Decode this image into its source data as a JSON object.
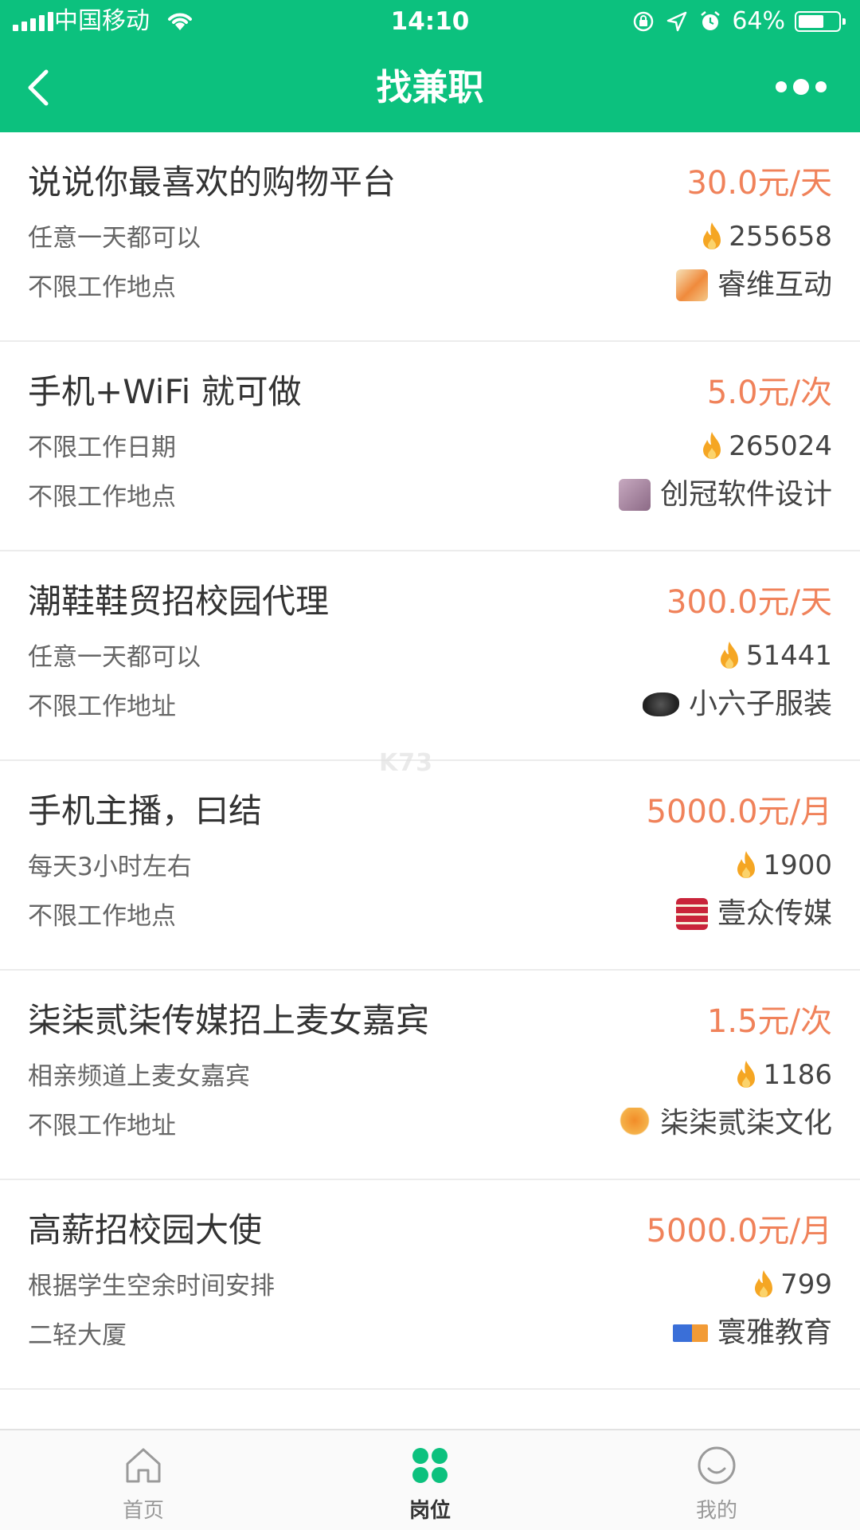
{
  "status_bar": {
    "carrier": "中国移动",
    "time": "14:10",
    "battery": "64%",
    "battery_level": 0.64
  },
  "nav": {
    "title": "找兼职",
    "back_icon": "chevron-left-icon",
    "more_icon": "more-dots-icon"
  },
  "colors": {
    "primary_green": "#0cc17e",
    "pay_orange": "#f0825a",
    "flame_orange": "#f5a623"
  },
  "jobs": [
    {
      "title": "说说你最喜欢的购物平台",
      "date": "任意一天都可以",
      "place": "不限工作地点",
      "pay": "30.0元/天",
      "hot": "255658",
      "company": "睿维互动"
    },
    {
      "title": "手机+WiFi 就可做",
      "date": "不限工作日期",
      "place": "不限工作地点",
      "pay": "5.0元/次",
      "hot": "265024",
      "company": "创冠软件设计"
    },
    {
      "title": "潮鞋鞋贸招校园代理",
      "date": "任意一天都可以",
      "place": "不限工作地址",
      "pay": "300.0元/天",
      "hot": "51441",
      "company": "小六子服装"
    },
    {
      "title": "手机主播，曰结",
      "date": "每天3小时左右",
      "place": "不限工作地点",
      "pay": "5000.0元/月",
      "hot": "1900",
      "company": "壹众传媒"
    },
    {
      "title": "柒柒贰柒传媒招上麦女嘉宾",
      "date": "相亲频道上麦女嘉宾",
      "place": "不限工作地址",
      "pay": "1.5元/次",
      "hot": "1186",
      "company": "柒柒贰柒文化"
    },
    {
      "title": "高薪招校园大使",
      "date": "根据学生空余时间安排",
      "place": "二轻大厦",
      "pay": "5000.0元/月",
      "hot": "799",
      "company": "寰雅教育"
    }
  ],
  "watermark": "K73",
  "tabs": [
    {
      "label": "首页",
      "icon": "home-icon",
      "active": false
    },
    {
      "label": "岗位",
      "icon": "grid-dots-icon",
      "active": true
    },
    {
      "label": "我的",
      "icon": "smiley-icon",
      "active": false
    }
  ]
}
